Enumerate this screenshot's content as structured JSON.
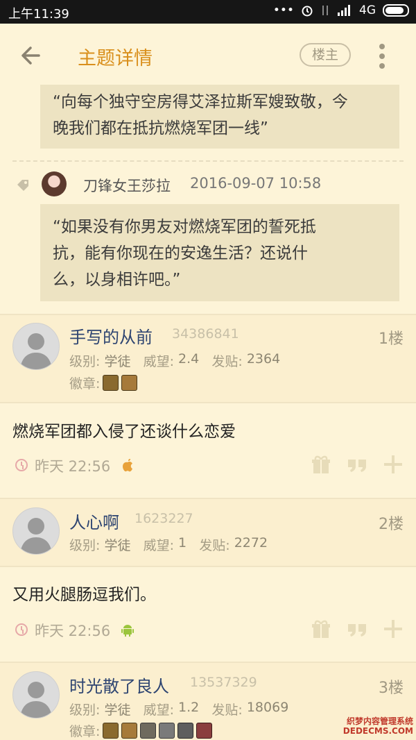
{
  "status_bar": {
    "time": "上午11:39",
    "network": "4G"
  },
  "app_bar": {
    "title": "主题详情",
    "owner_button": "楼主"
  },
  "quotes": {
    "top": {
      "lines": [
        "“向每个独守空房得艾泽拉斯军嫂致敬，今",
        "晚我们都在抵抗燃烧军团一线”"
      ]
    },
    "reply": {
      "author": "刀锋女王莎拉",
      "time": "2016-09-07 10:58",
      "lines": [
        "“如果没有你男友对燃烧军团的誓死抵",
        "抗，能有你现在的安逸生活？还说什",
        "么，以身相许吧。”"
      ]
    }
  },
  "labels": {
    "level": "级别:",
    "prestige": "威望:",
    "posts": "发贴:",
    "badges": "徽章:"
  },
  "posts": [
    {
      "name": "手写的从前",
      "id": "34386841",
      "floor": "1楼",
      "level": "学徒",
      "prestige": "2.4",
      "post_count": "2364",
      "badge_colors": [
        "#8a6a2e",
        "#a67a3a"
      ],
      "content": "燃烧军团都入侵了还谈什么恋爱",
      "time": "昨天 22:56",
      "device": "apple-icon"
    },
    {
      "name": "人心啊",
      "id": "1623227",
      "floor": "2楼",
      "level": "学徒",
      "prestige": "1",
      "post_count": "2272",
      "badge_colors": [],
      "content": "又用火腿肠逗我们。",
      "time": "昨天 22:56",
      "device": "android-icon"
    },
    {
      "name": "时光散了良人",
      "id": "13537329",
      "floor": "3楼",
      "level": "学徒",
      "prestige": "1.2",
      "post_count": "18069",
      "badge_colors": [
        "#8a6a2e",
        "#a67a3a",
        "#6f6a5e",
        "#7a7a7a",
        "#5e5e5e",
        "#8a3e3e"
      ],
      "content": "",
      "time": "",
      "device": ""
    }
  ],
  "watermark": {
    "line1": "织梦内容管理系统",
    "line2": "DEDECMS.COM"
  }
}
